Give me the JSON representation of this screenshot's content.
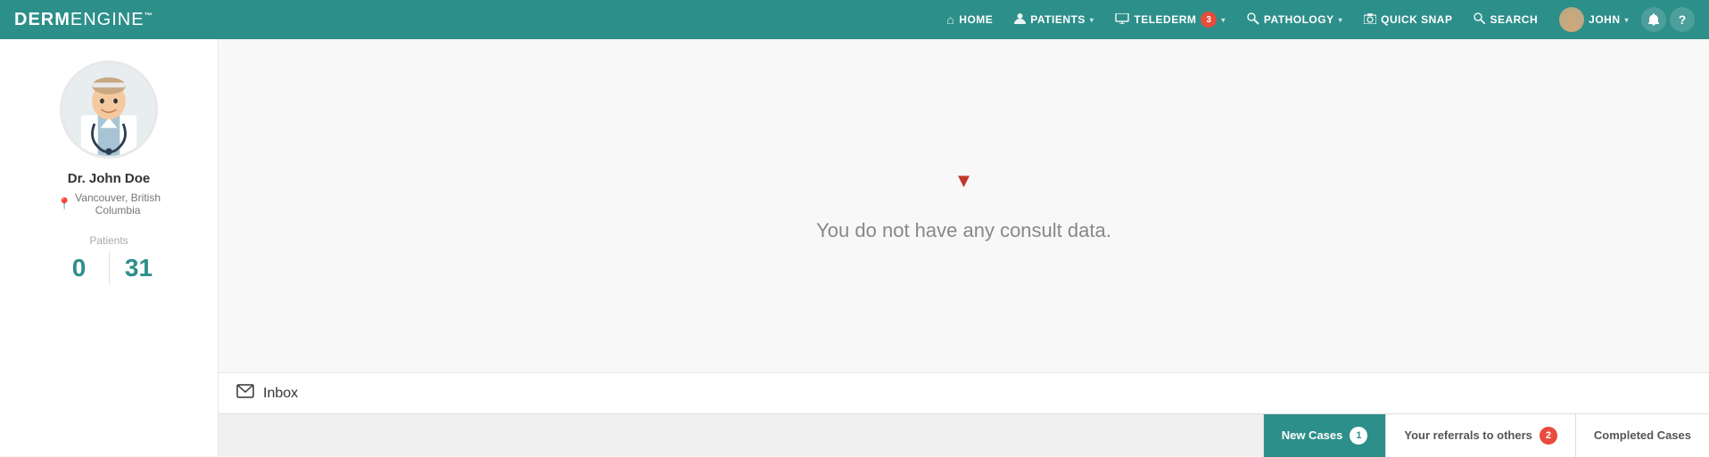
{
  "brand": {
    "derm": "DERM",
    "engine": "ENGINE",
    "tm": "™"
  },
  "navbar": {
    "items": [
      {
        "id": "home",
        "label": "HOME",
        "icon": "🏠",
        "hasCaret": false,
        "badge": null
      },
      {
        "id": "patients",
        "label": "PATIENTS",
        "icon": "👤",
        "hasCaret": true,
        "badge": null
      },
      {
        "id": "telederm",
        "label": "TELEDERM",
        "icon": "💻",
        "hasCaret": true,
        "badge": "3"
      },
      {
        "id": "pathology",
        "label": "PATHOLOGY",
        "icon": "🔬",
        "hasCaret": true,
        "badge": null
      },
      {
        "id": "quicksnap",
        "label": "QUICK SNAP",
        "icon": "📷",
        "hasCaret": false,
        "badge": null
      },
      {
        "id": "search",
        "label": "SEARCH",
        "icon": "🔍",
        "hasCaret": false,
        "badge": null
      }
    ],
    "user": "John",
    "user_caret": "▾"
  },
  "sidebar": {
    "doctor_name": "Dr. John Doe",
    "location_line1": "Vancouver, British",
    "location_line2": "Columbia",
    "patients_label": "Patients",
    "count_left": "0",
    "count_right": "31"
  },
  "content": {
    "no_data_message": "You do not have any consult data.",
    "funnel_symbol": "▼",
    "inbox_label": "Inbox"
  },
  "bottom_tabs": [
    {
      "id": "new-cases",
      "label": "New Cases",
      "badge": "1",
      "active": true
    },
    {
      "id": "referrals",
      "label": "Your referrals to others",
      "badge": "2",
      "active": false
    },
    {
      "id": "completed",
      "label": "Completed Cases",
      "badge": null,
      "active": false
    }
  ]
}
